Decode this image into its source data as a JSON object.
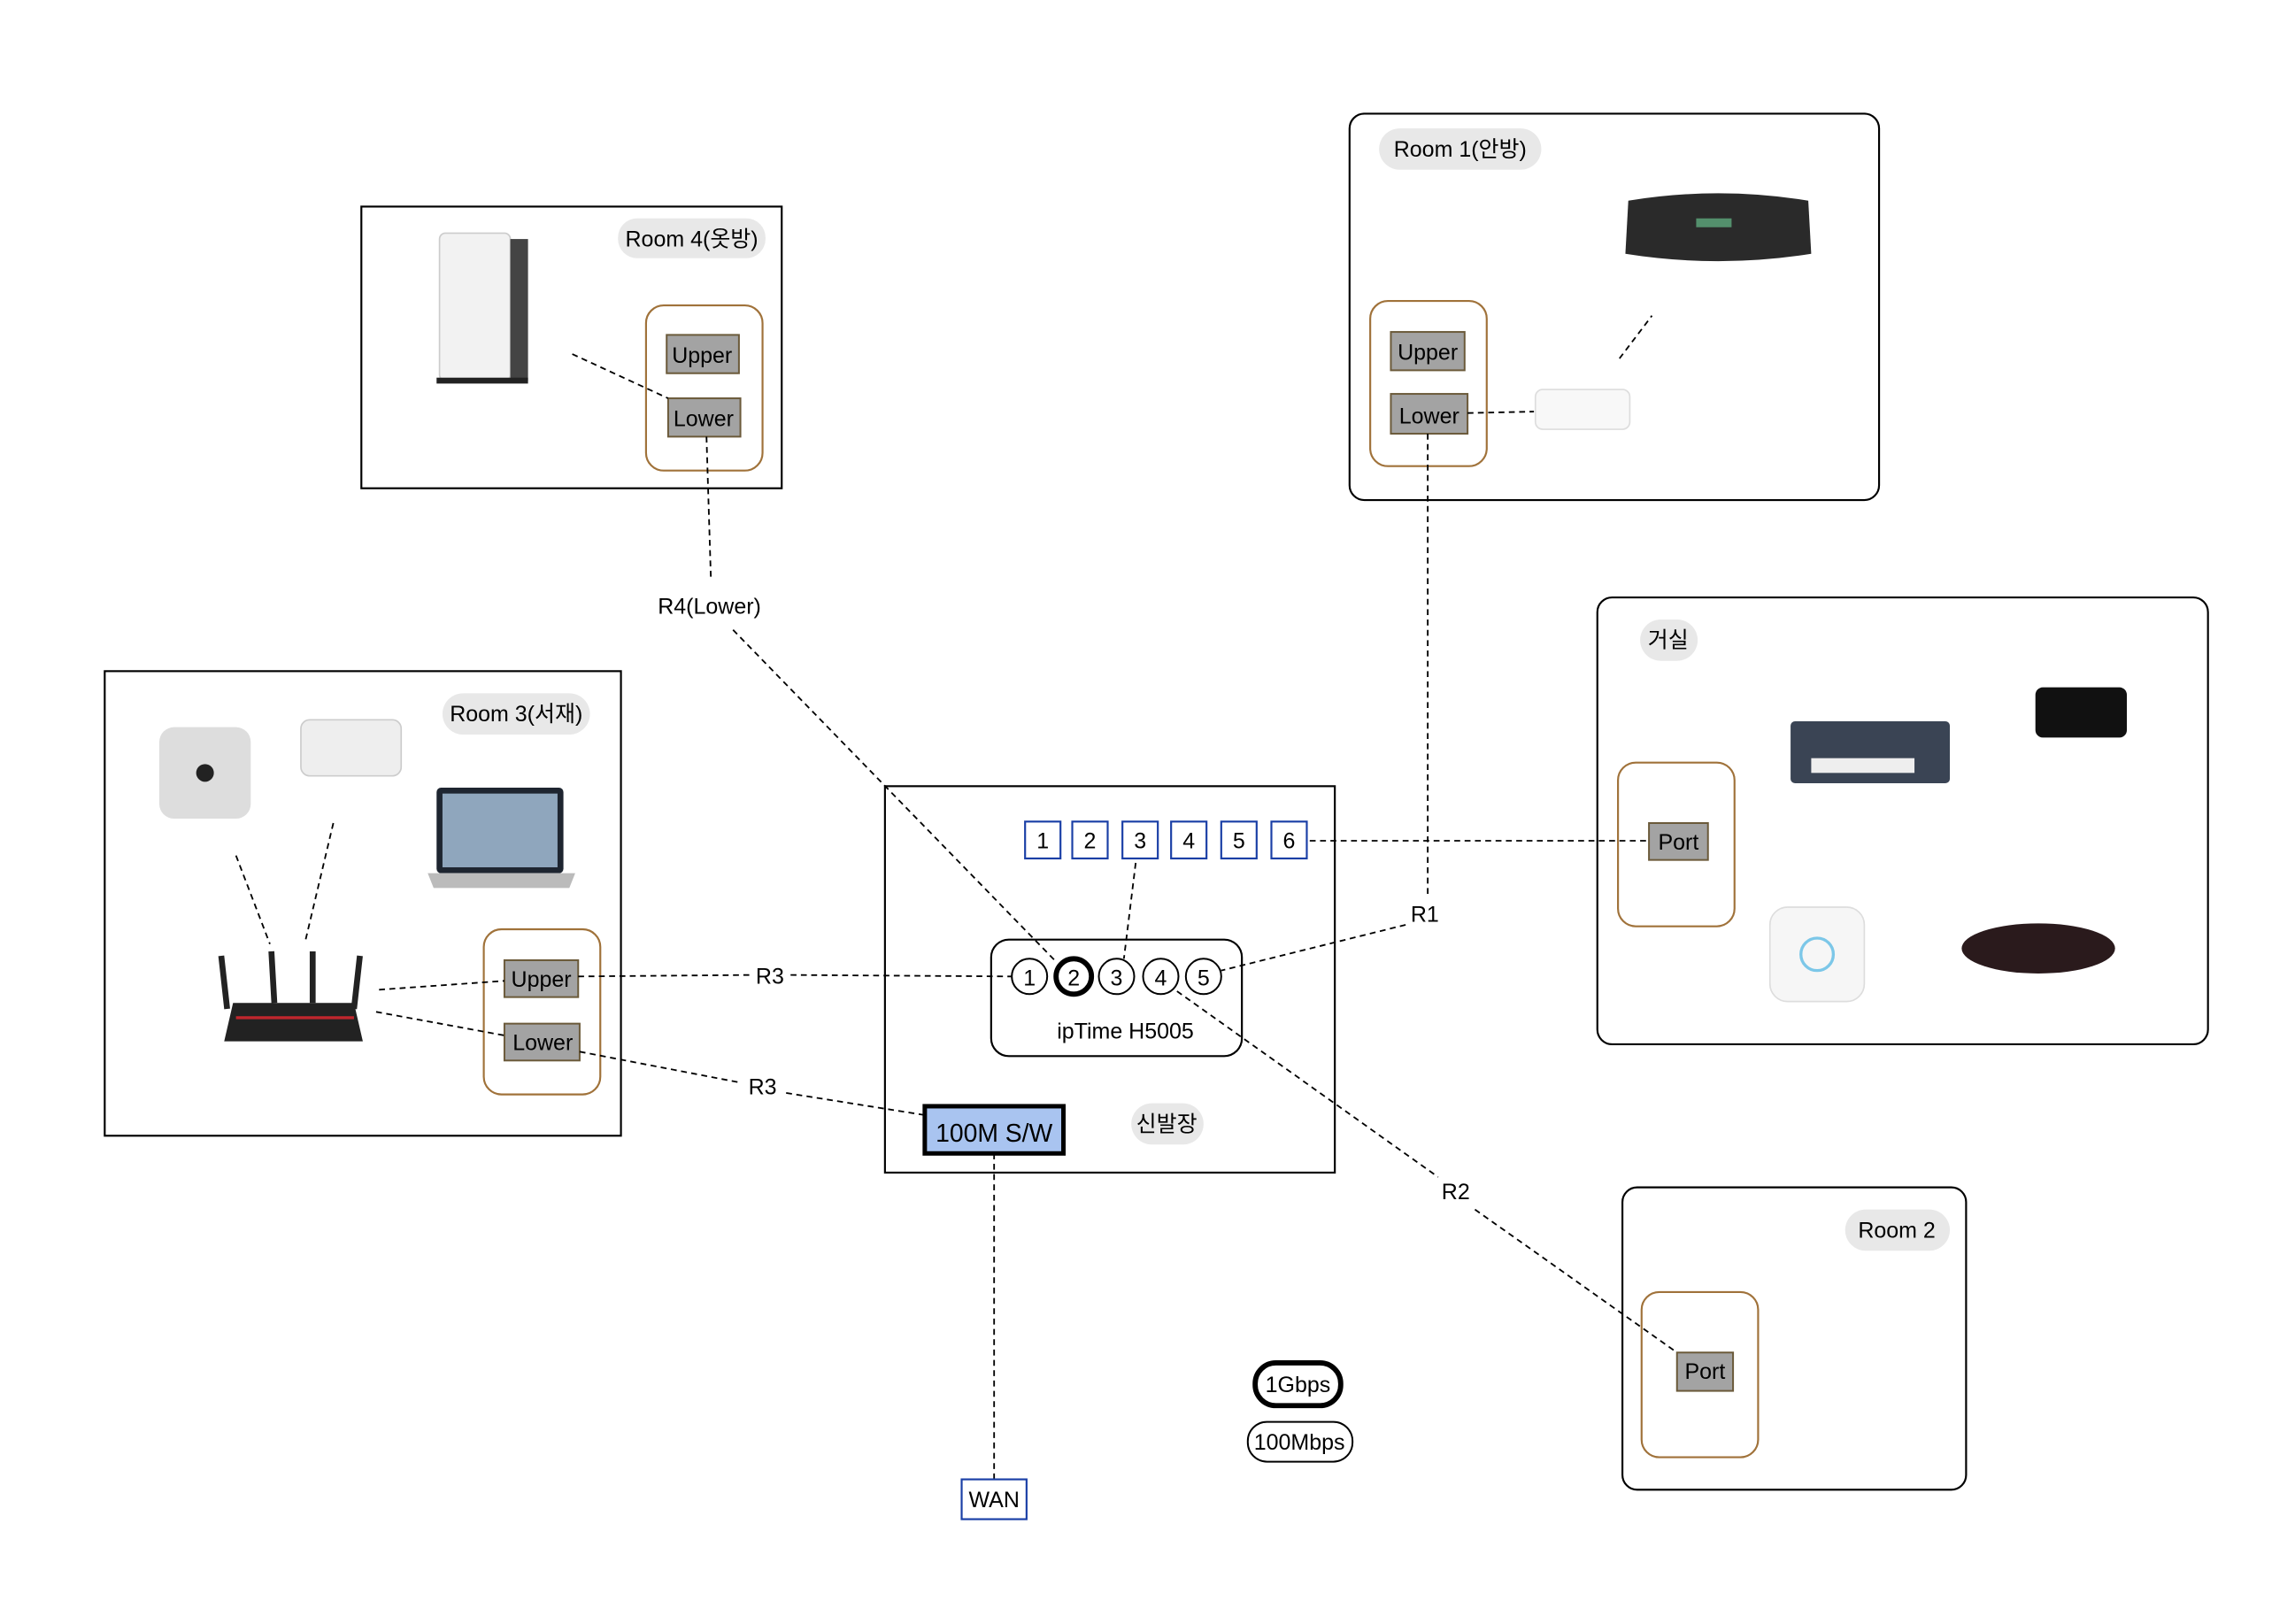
{
  "rooms": {
    "room4": {
      "label": "Room 4(옷방)",
      "upper": "Upper",
      "lower": "Lower"
    },
    "room1": {
      "label": "Room 1(안방)",
      "upper": "Upper",
      "lower": "Lower"
    },
    "living": {
      "label": "거실",
      "port": "Port"
    },
    "room3": {
      "label": "Room 3(서재)",
      "upper": "Upper",
      "lower": "Lower"
    },
    "room2": {
      "label": "Room 2",
      "port": "Port"
    },
    "entry": {
      "label": "신발장"
    }
  },
  "patch_ports": [
    "1",
    "2",
    "3",
    "4",
    "5",
    "6"
  ],
  "router": {
    "name": "ipTime H5005",
    "ports": [
      "1",
      "2",
      "3",
      "4",
      "5"
    ],
    "highlighted_port": "2"
  },
  "switch": {
    "label": "100M S/W",
    "color": "#a9c4f0"
  },
  "wan": {
    "label": "WAN"
  },
  "links": {
    "r4": "R4(Lower)",
    "r1": "R1",
    "r3_upper": "R3",
    "r3_lower": "R3",
    "r2": "R2"
  },
  "legend": {
    "gbps": "1Gbps",
    "mbps": "100Mbps"
  },
  "colors": {
    "outlet": "#a0723a",
    "socket": "#a3a3a3",
    "port_border": "#1a3fa6"
  }
}
